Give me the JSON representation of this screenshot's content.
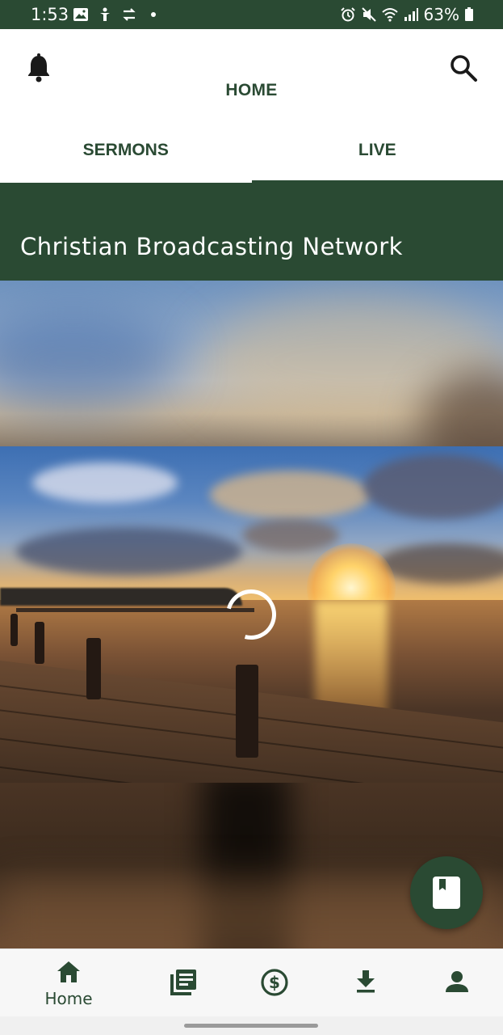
{
  "status_bar": {
    "time": "1:53",
    "battery": "63%",
    "left_icons": [
      "gallery-icon",
      "accessibility-icon",
      "sync-icon",
      "dot-icon"
    ],
    "right_icons": [
      "alarm-icon",
      "mute-icon",
      "wifi-icon",
      "signal-icon",
      "battery-icon"
    ]
  },
  "header": {
    "title": "HOME",
    "left_icon": "bell-icon",
    "right_icon": "search-icon"
  },
  "tabs": [
    {
      "label": "SERMONS",
      "active": false
    },
    {
      "label": "LIVE",
      "active": true
    }
  ],
  "channel": {
    "title": "Christian Broadcasting Network"
  },
  "player": {
    "state": "loading",
    "icon": "loading-spinner"
  },
  "fab": {
    "icon": "bookmark-book-icon"
  },
  "bottom_nav": {
    "items": [
      {
        "icon": "home-icon",
        "label": "Home",
        "active": true
      },
      {
        "icon": "library-icon",
        "label": ""
      },
      {
        "icon": "dollar-icon",
        "label": ""
      },
      {
        "icon": "download-icon",
        "label": ""
      },
      {
        "icon": "person-icon",
        "label": ""
      }
    ]
  },
  "colors": {
    "primary": "#2a4a33",
    "background": "#ffffff",
    "nav_background": "#f7f7f7"
  }
}
